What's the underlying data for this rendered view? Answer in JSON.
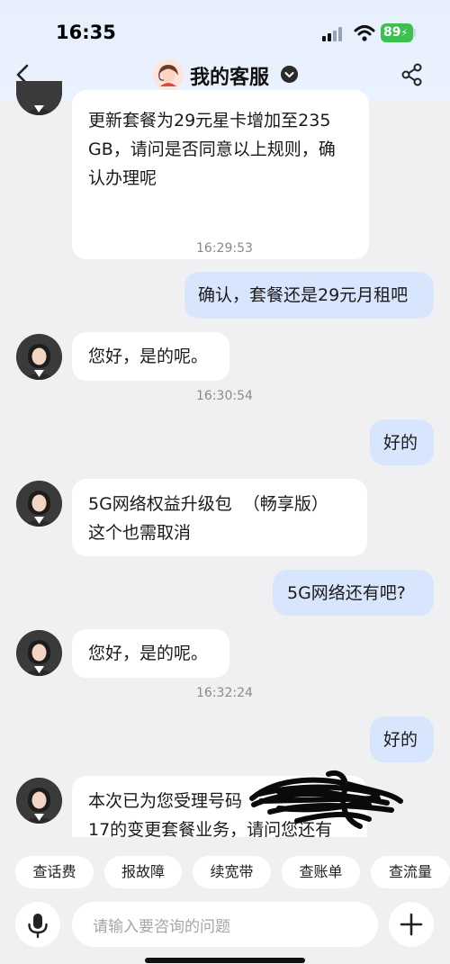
{
  "status_bar": {
    "time": "16:35",
    "battery": "89"
  },
  "header": {
    "title": "我的客服"
  },
  "messages": [
    {
      "lines": [
        "更新套餐为29元星卡增加至235",
        "GB，请问是否同意以上规则，确",
        "认办理呢"
      ],
      "time": "16:29:53"
    },
    {
      "text": "确认，套餐还是29元月租吧"
    },
    {
      "text": "您好，是的呢。",
      "time": "16:30:54"
    },
    {
      "text": "好的"
    },
    {
      "lines": [
        "5G网络权益升级包  （畅享版）",
        "这个也需取消"
      ]
    },
    {
      "text": "5G网络还有吧?"
    },
    {
      "text": "您好，是的呢。",
      "time": "16:32:24"
    },
    {
      "text": "好的"
    },
    {
      "lines": [
        "本次已为您受理号码",
        "17的变更套餐业务，请问您还有"
      ]
    }
  ],
  "quick_actions": [
    "查话费",
    "报故障",
    "续宽带",
    "查账单",
    "查流量"
  ],
  "input": {
    "placeholder": "请输入要咨询的问题"
  },
  "colors": {
    "header_bg": "#e8f0fe",
    "user_bubble": "#d7e6fd",
    "agent_bubble": "#ffffff",
    "battery": "#3cc04f"
  }
}
